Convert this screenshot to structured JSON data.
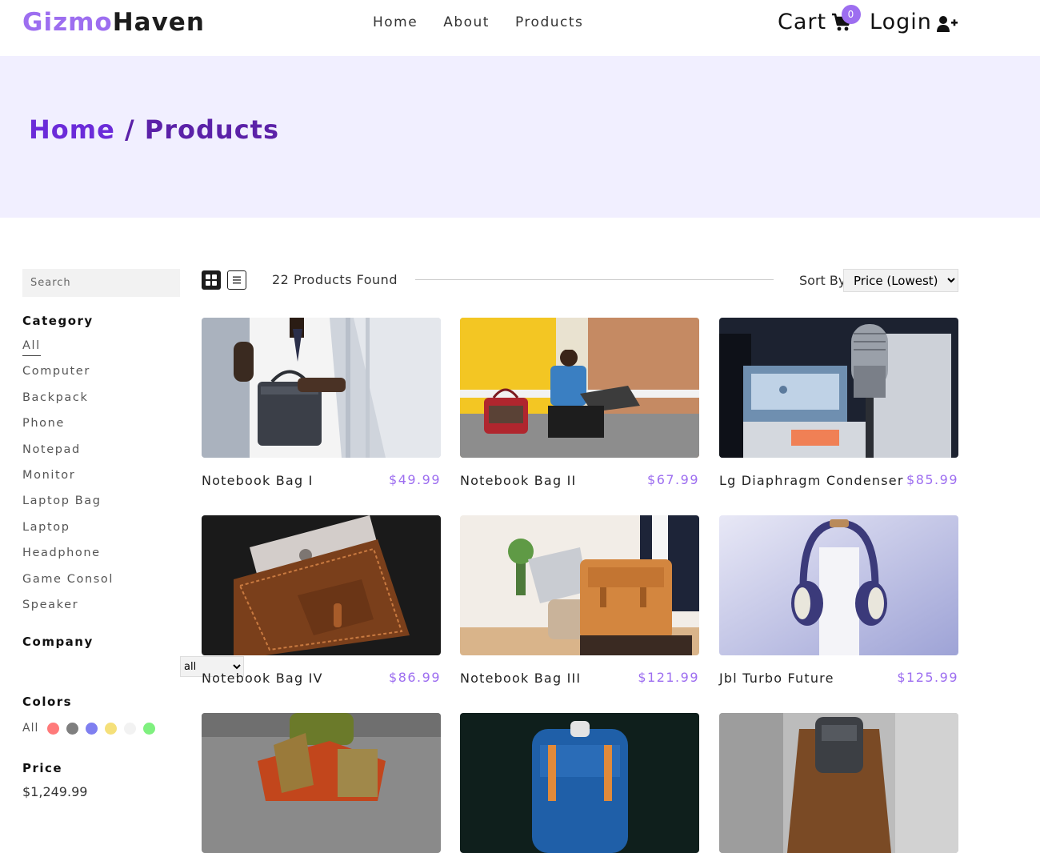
{
  "brand": {
    "accent": "Gizmo",
    "rest": "Haven",
    "accent_color": "#9d6ef0"
  },
  "nav": {
    "links": [
      "Home",
      "About",
      "Products"
    ]
  },
  "cart": {
    "label": "Cart",
    "count": "0",
    "icon": "shopping-cart-icon"
  },
  "login": {
    "label": "Login",
    "icon": "user-plus-icon"
  },
  "hero": {
    "home": "Home",
    "separator": "/",
    "current": "Products"
  },
  "sidebar": {
    "search_placeholder": "Search",
    "category_title": "Category",
    "categories": [
      "All",
      "Computer",
      "Backpack",
      "Phone",
      "Notepad",
      "Monitor",
      "Laptop Bag",
      "Laptop",
      "Headphone",
      "Game Consol",
      "Speaker"
    ],
    "active_category": "All",
    "company_title": "Company",
    "company_selected": "all",
    "colors_title": "Colors",
    "colors_all": "All",
    "colors": [
      "#ff7a7a",
      "#7f7f7f",
      "#7f7ff0",
      "#f5e07a",
      "#f2f2f2",
      "#7ff07f"
    ],
    "price_title": "Price",
    "price_value": "$1,249.99"
  },
  "toolbar": {
    "found": "22 Products Found",
    "sort_label": "Sort By",
    "sort_selected": "Price (Lowest)",
    "grid_icon": "grid-view-icon",
    "list_icon": "list-view-icon"
  },
  "products": [
    {
      "name": "Notebook Bag I",
      "price": "$49.99"
    },
    {
      "name": "Notebook Bag II",
      "price": "$67.99"
    },
    {
      "name": "Lg Diaphragm Condenser",
      "price": "$85.99"
    },
    {
      "name": "Notebook Bag IV",
      "price": "$86.99"
    },
    {
      "name": "Notebook Bag III",
      "price": "$121.99"
    },
    {
      "name": "Jbl Turbo Future",
      "price": "$125.99"
    },
    {
      "name": "",
      "price": ""
    },
    {
      "name": "",
      "price": ""
    },
    {
      "name": "",
      "price": ""
    }
  ]
}
